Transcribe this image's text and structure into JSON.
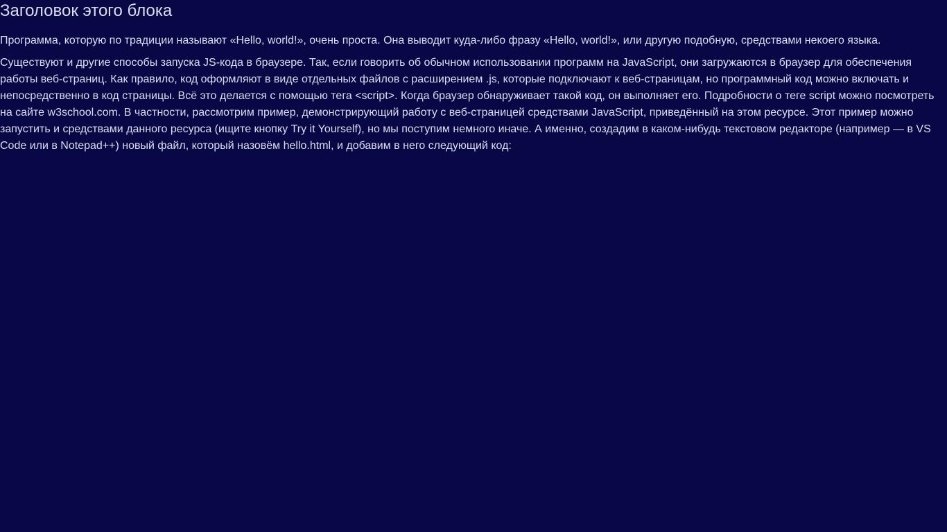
{
  "block": {
    "title": "Заголовок этого блока",
    "paragraphs": [
      "Программа, которую по традиции называют «Hello, world!», очень проста. Она выводит куда-либо фразу «Hello, world!», или другую подобную, средствами некоего языка.",
      "Существуют и другие способы запуска JS-кода в браузере. Так, если говорить об обычном использовании программ на JavaScript, они загружаются в браузер для обеспечения работы веб-страниц. Как правило, код оформляют в виде отдельных файлов с расширением .js, которые подключают к веб-страницам, но программный код можно включать и непосредственно в код страницы. Всё это делается с помощью тега <script>. Когда браузер обнаруживает такой код, он выполняет его. Подробности о теге script можно посмотреть на сайте w3school.com. В частности, рассмотрим пример, демонстрирующий работу с веб-страницей средствами JavaScript, приведённый на этом ресурсе. Этот пример можно запустить и средствами данного ресурса (ищите кнопку Try it Yourself), но мы поступим немного иначе. А именно, создадим в каком-нибудь текстовом редакторе (например — в VS Code или в Notepad++) новый файл, который назовём hello.html, и добавим в него следующий код:"
    ]
  },
  "colors": {
    "background": "#090847",
    "text": "#dcdcf0"
  }
}
